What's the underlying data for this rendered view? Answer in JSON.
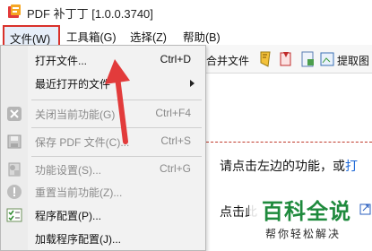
{
  "window": {
    "title": "PDF 补丁丁 [1.0.0.3740]"
  },
  "menubar": {
    "file": "文件(W)",
    "tools": "工具箱(G)",
    "select": "选择(Z)",
    "help": "帮助(B)"
  },
  "toolbar": {
    "merge_label": "合并文件",
    "extract_label": "提取图"
  },
  "file_menu": {
    "items": [
      {
        "label": "打开文件...",
        "shortcut": "Ctrl+D",
        "disabled": false
      },
      {
        "label": "最近打开的文件",
        "shortcut": "",
        "disabled": false
      },
      {
        "label": "关闭当前功能(G)",
        "shortcut": "Ctrl+F4",
        "disabled": true
      },
      {
        "label": "保存 PDF 文件(C)...",
        "shortcut": "Ctrl+S",
        "disabled": true
      },
      {
        "label": "功能设置(S)...",
        "shortcut": "Ctrl+G",
        "disabled": true
      },
      {
        "label": "重置当前功能(Z)...",
        "shortcut": "",
        "disabled": true
      },
      {
        "label": "程序配置(P)...",
        "shortcut": "",
        "disabled": false
      },
      {
        "label": "加载程序配置(J)...",
        "shortcut": "",
        "disabled": false
      }
    ]
  },
  "content": {
    "hint_line1": "请点击左边的功能，或",
    "hint_line1_link": "打",
    "hint_line2": "点击此"
  },
  "watermark": {
    "main": "百科全说",
    "sub": "帮你轻松解决"
  },
  "colors": {
    "highlight_border": "#d9312b",
    "annotation_arrow": "#e23b3b",
    "watermark_green": "#1f8a3d",
    "link_blue": "#1a66d6"
  }
}
